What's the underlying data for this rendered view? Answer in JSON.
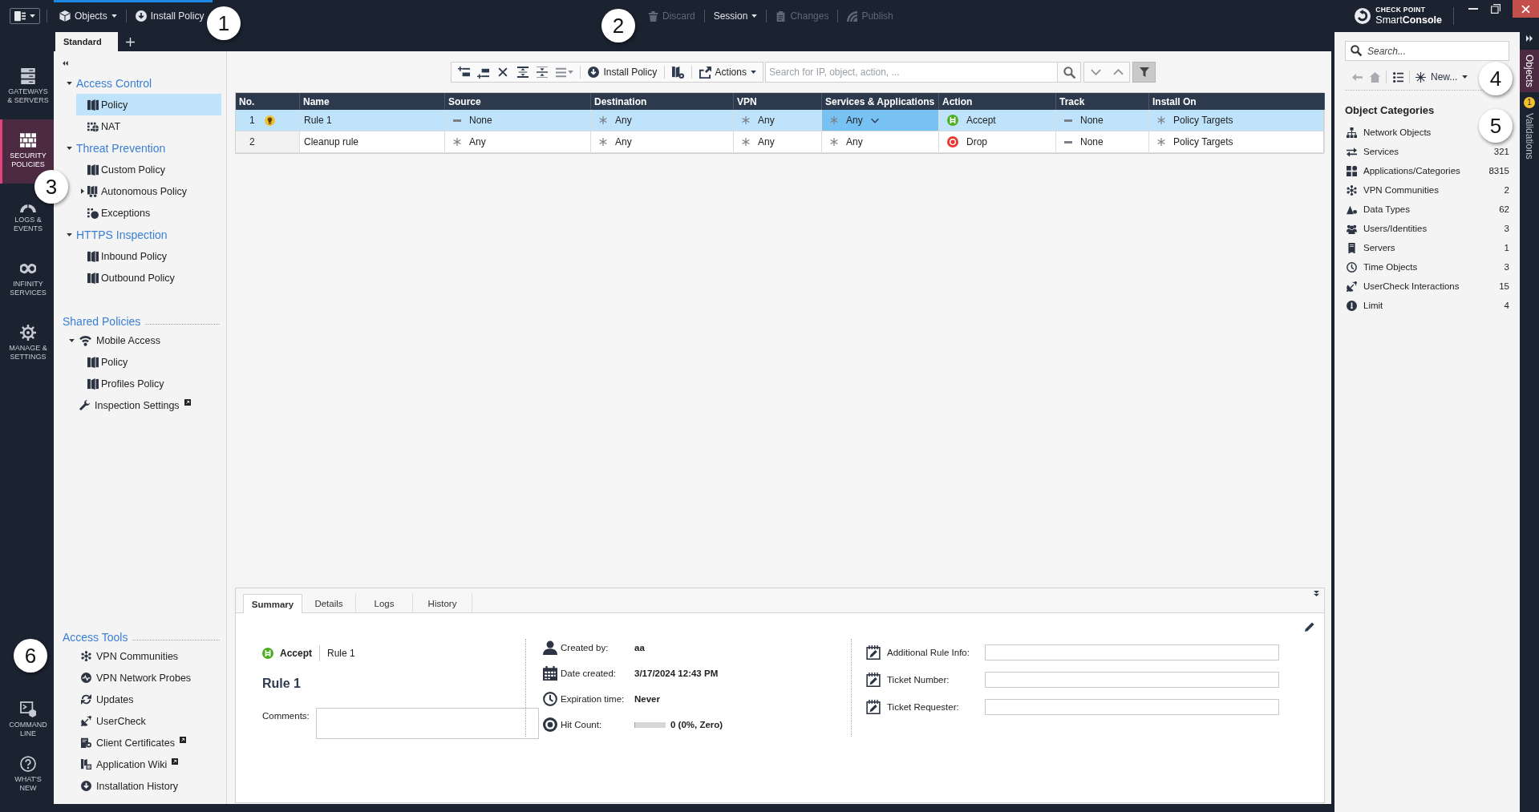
{
  "top_bar": {
    "quick_actions": [
      {
        "label": "Objects",
        "dropdown": true
      },
      {
        "label": "Install Policy",
        "dropdown": false
      }
    ],
    "session_actions": [
      {
        "label": "Discard",
        "disabled": true,
        "dropdown": false
      },
      {
        "label": "Session",
        "disabled": false,
        "dropdown": true
      },
      {
        "label": "Changes",
        "disabled": true,
        "dropdown": false
      },
      {
        "label": "Publish",
        "disabled": true,
        "dropdown": false
      }
    ],
    "brand": {
      "company": "CHECK POINT",
      "product": "Smart**Console**"
    }
  },
  "policy_tabs": [
    {
      "label": "Standard",
      "selected": true
    }
  ],
  "nav_rail": [
    {
      "label": "GATEWAYS & SERVERS",
      "selected": false
    },
    {
      "label": "SECURITY POLICIES",
      "selected": true
    },
    {
      "label": "LOGS & EVENTS",
      "selected": false
    },
    {
      "label": "INFINITY SERVICES",
      "selected": false
    },
    {
      "label": "MANAGE & SETTINGS",
      "selected": false
    }
  ],
  "nav_rail_bottom": [
    {
      "label": "COMMAND LINE"
    },
    {
      "label": "WHAT'S NEW"
    }
  ],
  "policy_tree": [
    {
      "label": "Access Control",
      "expanded": true,
      "children": [
        {
          "label": "Policy",
          "kind": "policy",
          "selected": true
        },
        {
          "label": "NAT",
          "kind": "nat",
          "selected": false
        }
      ]
    },
    {
      "label": "Threat Prevention",
      "expanded": true,
      "children": [
        {
          "label": "Custom Policy",
          "kind": "policy",
          "selected": false
        },
        {
          "label": "Autonomous Policy",
          "kind": "autonomous",
          "selected": false,
          "expanded": false
        },
        {
          "label": "Exceptions",
          "kind": "exceptions",
          "selected": false
        }
      ]
    },
    {
      "label": "HTTPS Inspection",
      "expanded": true,
      "children": [
        {
          "label": "Inbound Policy",
          "kind": "policy",
          "selected": false
        },
        {
          "label": "Outbound Policy",
          "kind": "policy",
          "selected": false
        }
      ]
    }
  ],
  "shared_policies": {
    "title": "Shared Policies",
    "items": [
      {
        "label": "Mobile Access",
        "kind": "blade",
        "selected": false,
        "external": false,
        "expanded": true,
        "children": [
          {
            "label": "Policy",
            "kind": "policy",
            "selected": false
          },
          {
            "label": "Profiles Policy",
            "kind": "policy",
            "selected": false
          }
        ]
      },
      {
        "label": "Inspection Settings",
        "kind": "settings",
        "selected": false,
        "external": true
      }
    ]
  },
  "access_tools": {
    "title": "Access Tools",
    "items": [
      {
        "label": "VPN Communities",
        "external": false
      },
      {
        "label": "VPN Network Probes",
        "external": false
      },
      {
        "label": "Updates",
        "external": false
      },
      {
        "label": "UserCheck",
        "external": false
      },
      {
        "label": "Client Certificates",
        "external": true
      },
      {
        "label": "Application Wiki",
        "external": true
      },
      {
        "label": "Installation History",
        "external": false
      }
    ]
  },
  "rulebase_toolbar": {
    "install_label": "Install Policy",
    "actions_label": "Actions",
    "search": {
      "placeholder": "Search for IP, object, action, ..."
    },
    "filter_active": true
  },
  "rule_table": {
    "columns": [
      "No.",
      "Name",
      "Source",
      "Destination",
      "VPN",
      "Services & Applications",
      "Action",
      "Track",
      "Install On"
    ],
    "rows": [
      {
        "hint": true,
        "selected": true,
        "cells": [
          {
            "text": "1",
            "kind": "number",
            "focused": false
          },
          {
            "text": "Rule 1",
            "kind": "text",
            "focused": false
          },
          {
            "text": "None",
            "kind": "none",
            "focused": false
          },
          {
            "text": "Any",
            "kind": "any",
            "focused": false
          },
          {
            "text": "Any",
            "kind": "any",
            "focused": false
          },
          {
            "text": "Any",
            "kind": "any",
            "focused": true
          },
          {
            "text": "Accept",
            "kind": "accept",
            "focused": false
          },
          {
            "text": "None",
            "kind": "none",
            "focused": false
          },
          {
            "text": "Policy Targets",
            "kind": "any",
            "focused": false
          }
        ]
      },
      {
        "hint": false,
        "selected": false,
        "cells": [
          {
            "text": "2",
            "kind": "number",
            "focused": false
          },
          {
            "text": "Cleanup rule",
            "kind": "text",
            "focused": false
          },
          {
            "text": "Any",
            "kind": "any",
            "focused": false
          },
          {
            "text": "Any",
            "kind": "any",
            "focused": false
          },
          {
            "text": "Any",
            "kind": "any",
            "focused": false
          },
          {
            "text": "Any",
            "kind": "any",
            "focused": false
          },
          {
            "text": "Drop",
            "kind": "drop",
            "focused": false
          },
          {
            "text": "None",
            "kind": "none",
            "focused": false
          },
          {
            "text": "Policy Targets",
            "kind": "any",
            "focused": false
          }
        ]
      }
    ]
  },
  "rule_details": {
    "tabs": [
      {
        "label": "Summary",
        "selected": true
      },
      {
        "label": "Details",
        "selected": false
      },
      {
        "label": "Logs",
        "selected": false
      },
      {
        "label": "History",
        "selected": false
      }
    ],
    "action": {
      "label": "Accept",
      "kind": "accept"
    },
    "rule_ref": "Rule 1",
    "title": "Rule 1",
    "comments_label": "Comments:",
    "info": [
      {
        "label": "Created by:",
        "value": "aa"
      },
      {
        "label": "Date created:",
        "value": "3/17/2024 12:43 PM"
      },
      {
        "label": "Expiration time:",
        "value": "Never"
      },
      {
        "label": "Hit Count:",
        "value": "0 (0%, Zero)",
        "level": 0
      }
    ],
    "fields": [
      {
        "label": "Additional Rule Info:"
      },
      {
        "label": "Ticket Number:"
      },
      {
        "label": "Ticket Requester:"
      }
    ]
  },
  "objects_panel": {
    "search": {
      "placeholder": "Search..."
    },
    "new_label": "New...",
    "title": "Object Categories",
    "categories": [
      {
        "label": "Network Objects"
      },
      {
        "label": "Services",
        "count": "321"
      },
      {
        "label": "Applications/Categories",
        "count": "8315"
      },
      {
        "label": "VPN Communities",
        "count": "2"
      },
      {
        "label": "Data Types",
        "count": "62"
      },
      {
        "label": "Users/Identities",
        "count": "3"
      },
      {
        "label": "Servers",
        "count": "1"
      },
      {
        "label": "Time Objects",
        "count": "3"
      },
      {
        "label": "UserCheck Interactions",
        "count": "15"
      },
      {
        "label": "Limit",
        "count": "4"
      }
    ]
  },
  "side_tabs": [
    {
      "label": "Objects",
      "selected": true
    },
    {
      "label": "Validations",
      "selected": false,
      "badge": "1"
    }
  ],
  "callouts": [
    "1",
    "2",
    "3",
    "4",
    "5",
    "6"
  ]
}
